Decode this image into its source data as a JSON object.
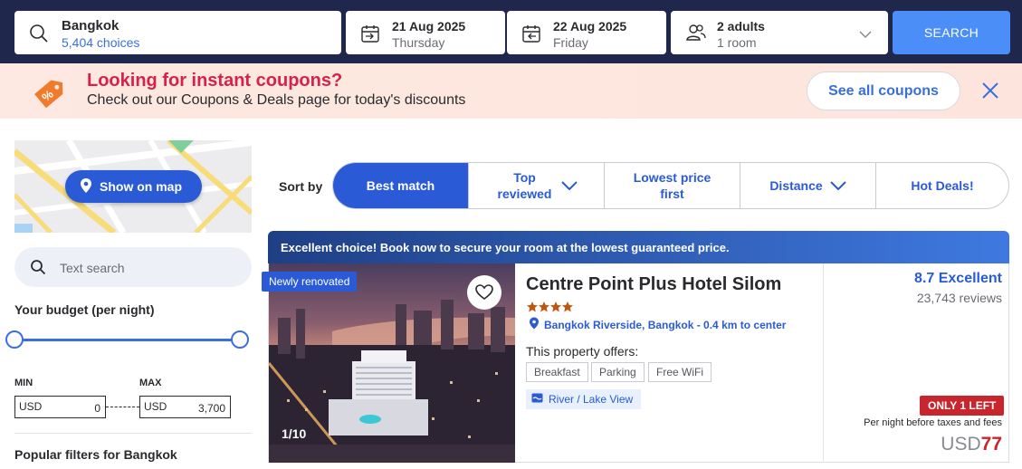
{
  "search": {
    "destination": "Bangkok",
    "choices": "5,404 choices",
    "checkin_date": "21 Aug 2025",
    "checkin_day": "Thursday",
    "checkout_date": "22 Aug 2025",
    "checkout_day": "Friday",
    "guests": "2 adults",
    "rooms": "1 room",
    "search_label": "SEARCH"
  },
  "promo": {
    "headline": "Looking for instant coupons?",
    "subtext": "Check out our Coupons & Deals page for today's discounts",
    "button": "See all coupons"
  },
  "sidebar": {
    "show_on_map": "Show on map",
    "text_search_placeholder": "Text search",
    "budget_title": "Your budget (per night)",
    "min_label": "MIN",
    "max_label": "MAX",
    "min_currency": "USD",
    "min_value": "0",
    "max_currency": "USD",
    "max_value": "3,700",
    "budget_range": {
      "min": 0,
      "max": 3700
    },
    "popular_filters": "Popular filters for Bangkok"
  },
  "sort": {
    "label": "Sort by",
    "options": [
      {
        "label": "Best match",
        "active": true
      },
      {
        "label": "Top reviewed",
        "dropdown": true
      },
      {
        "label": "Lowest price first"
      },
      {
        "label": "Distance",
        "dropdown": true
      },
      {
        "label": "Hot Deals!"
      }
    ]
  },
  "listing": {
    "banner": "Excellent choice! Book now to secure your room at the lowest guaranteed price.",
    "badge": "Newly renovated",
    "photo_counter": "1/10",
    "name": "Centre Point Plus Hotel Silom",
    "stars": 4,
    "location": "Bangkok Riverside, Bangkok - 0.4 km to center",
    "offers_label": "This property offers:",
    "amenities": [
      "Breakfast",
      "Parking",
      "Free WiFi"
    ],
    "view": "River / Lake View",
    "score": "8.7 Excellent",
    "reviews": "23,743 reviews",
    "urgency": "ONLY 1 LEFT",
    "price_note": "Per night before taxes and fees",
    "currency": "USD",
    "price": "77"
  },
  "colors": {
    "navy": "#20274d",
    "accent_blue": "#2a5ad6",
    "search_button": "#4c8ef7",
    "promo_pink": "#d6224a",
    "alert_red": "#c8262c",
    "star_orange": "#c2550d"
  }
}
